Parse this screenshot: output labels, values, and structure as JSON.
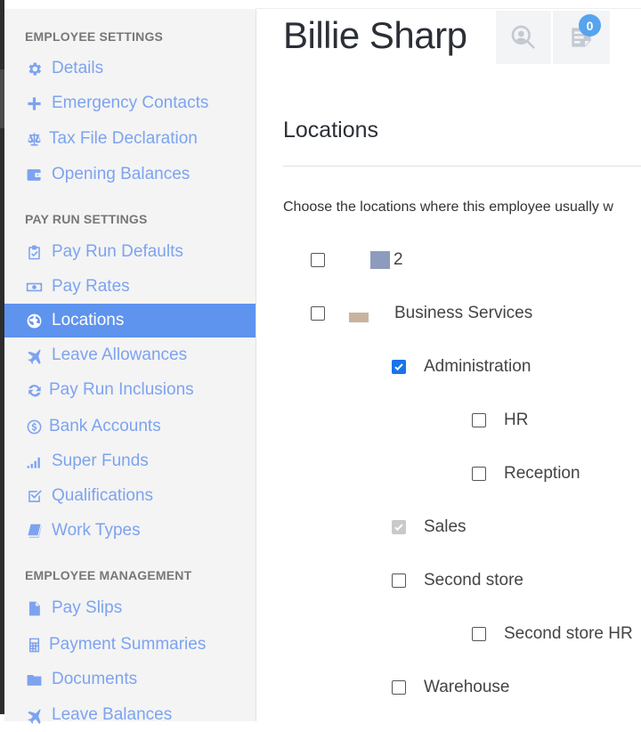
{
  "sidebar": {
    "sections": [
      {
        "heading": "EMPLOYEE SETTINGS",
        "items": [
          {
            "label": "Details",
            "icon": "gear-icon"
          },
          {
            "label": "Emergency Contacts",
            "icon": "plus-icon"
          },
          {
            "label": "Tax File Declaration",
            "icon": "scales-icon"
          },
          {
            "label": "Opening Balances",
            "icon": "wallet-icon"
          }
        ]
      },
      {
        "heading": "PAY RUN SETTINGS",
        "items": [
          {
            "label": "Pay Run Defaults",
            "icon": "clipboard-check-icon"
          },
          {
            "label": "Pay Rates",
            "icon": "money-icon"
          },
          {
            "label": "Locations",
            "icon": "globe-icon",
            "active": true
          },
          {
            "label": "Leave Allowances",
            "icon": "plane-icon"
          },
          {
            "label": "Pay Run Inclusions",
            "icon": "refresh-icon"
          },
          {
            "label": "Bank Accounts",
            "icon": "dollar-circle-icon"
          },
          {
            "label": "Super Funds",
            "icon": "signal-bars-icon"
          },
          {
            "label": "Qualifications",
            "icon": "check-square-icon"
          },
          {
            "label": "Work Types",
            "icon": "book-icon"
          }
        ]
      },
      {
        "heading": "EMPLOYEE MANAGEMENT",
        "items": [
          {
            "label": "Pay Slips",
            "icon": "file-icon"
          },
          {
            "label": "Payment Summaries",
            "icon": "calculator-icon"
          },
          {
            "label": "Documents",
            "icon": "folder-icon"
          },
          {
            "label": "Leave Balances",
            "icon": "plane-icon"
          }
        ]
      }
    ],
    "accent": "#7da3f0",
    "active_bg": "#5e93ee"
  },
  "header": {
    "employee_name": "Billie Sharp",
    "notes_count": "0"
  },
  "locations": {
    "title": "Locations",
    "instruction": "Choose the locations where this employee usually w",
    "items": [
      {
        "label": "2",
        "checked": false
      },
      {
        "label": "Business Services",
        "checked": false
      },
      {
        "label": "Administration",
        "checked": true
      },
      {
        "label": "HR",
        "checked": false
      },
      {
        "label": "Reception",
        "checked": false
      },
      {
        "label": "Sales",
        "checked": true,
        "disabled": true
      },
      {
        "label": "Second store",
        "checked": false
      },
      {
        "label": "Second store HR",
        "checked": false
      },
      {
        "label": "Warehouse",
        "checked": false
      }
    ]
  }
}
